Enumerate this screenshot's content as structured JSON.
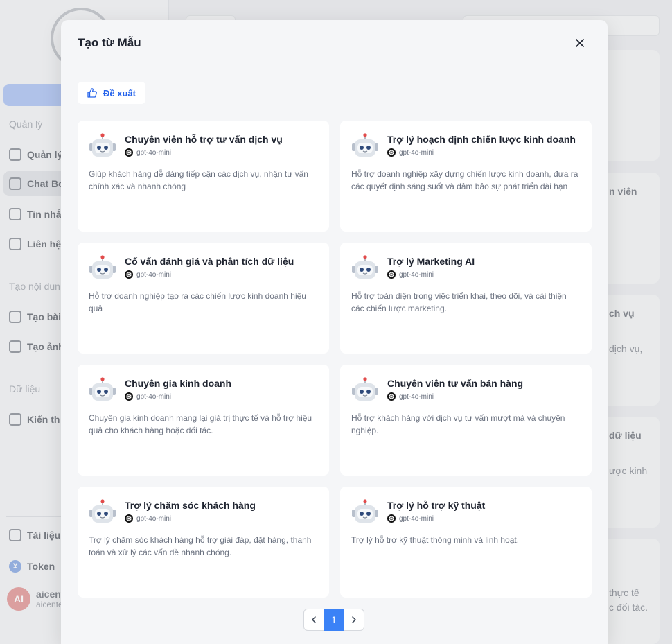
{
  "background": {
    "sidebar": {
      "section_manage": "Quản lý",
      "nav_manage": "Quản lý",
      "nav_chatbot": "Chat Bo",
      "nav_messages": "Tin nhắ",
      "nav_contacts": "Liên hệ",
      "section_content": "Tạo nội dun",
      "nav_create_post": "Tạo bài",
      "nav_create_image": "Tạo ảnh",
      "section_data": "Dữ liệu",
      "nav_knowledge": "Kiến th",
      "nav_docs": "Tài liệu",
      "nav_token": "Token",
      "token_icon_glyph": "¥",
      "user_avatar": "AI",
      "user_name": "aicent",
      "user_email": "aicente"
    },
    "right_snippets": {
      "s1": "n viên",
      "s2": "ch vụ",
      "s3": "dịch vụ,",
      "s4": "dữ liệu",
      "s5": "ược kinh",
      "s6": "thực tế",
      "s7": "c đối tác."
    }
  },
  "modal": {
    "title": "Tạo từ Mẫu",
    "filter_label": "Đề xuất",
    "templates": [
      {
        "title": "Chuyên viên hỗ trợ tư vấn dịch vụ",
        "model": "gpt-4o-mini",
        "desc": "Giúp khách hàng dễ dàng tiếp cận các dịch vụ, nhận tư vấn chính xác và nhanh chóng"
      },
      {
        "title": "Trợ lý hoạch định chiến lược kinh doanh",
        "model": "gpt-4o-mini",
        "desc": "Hỗ trợ doanh nghiệp xây dựng chiến lược kinh doanh, đưa ra các quyết định sáng suốt và đảm bảo sự phát triển dài hạn"
      },
      {
        "title": "Cố vấn đánh giá và phân tích dữ liệu",
        "model": "gpt-4o-mini",
        "desc": "Hỗ trợ doanh nghiệp tạo ra các chiến lược kinh doanh hiệu quả"
      },
      {
        "title": "Trợ lý Marketing AI",
        "model": "gpt-4o-mini",
        "desc": "Hỗ trợ toàn diện trong việc triển khai, theo dõi, và cải thiện các chiến lược marketing."
      },
      {
        "title": "Chuyên gia kinh doanh",
        "model": "gpt-4o-mini",
        "desc": "Chuyên gia kinh doanh mang lại giá trị thực tế và hỗ trợ hiệu quả cho khách hàng hoặc đối tác."
      },
      {
        "title": "Chuyên viên tư vấn bán hàng",
        "model": "gpt-4o-mini",
        "desc": "Hỗ trợ khách hàng với dịch vụ tư vấn mượt mà và chuyên nghiệp."
      },
      {
        "title": "Trợ lý chăm sóc khách hàng",
        "model": "gpt-4o-mini",
        "desc": "Trợ lý chăm sóc khách hàng hỗ trợ giải đáp, đặt hàng, thanh toán và xử lý các vấn đề nhanh chóng."
      },
      {
        "title": "Trợ lý hỗ trợ kỹ thuật",
        "model": "gpt-4o-mini",
        "desc": "Trợ lý hỗ trợ kỹ thuật thông minh và linh hoạt."
      }
    ],
    "pagination": {
      "current_page": "1"
    }
  },
  "colors": {
    "accent": "#3b82f6",
    "link": "#2563eb"
  },
  "icons": {
    "close": "close-icon",
    "filter": "thumbs-up-icon",
    "prev": "chevron-left-icon",
    "next": "chevron-right-icon",
    "bot": "robot-icon",
    "model": "openai-icon"
  }
}
